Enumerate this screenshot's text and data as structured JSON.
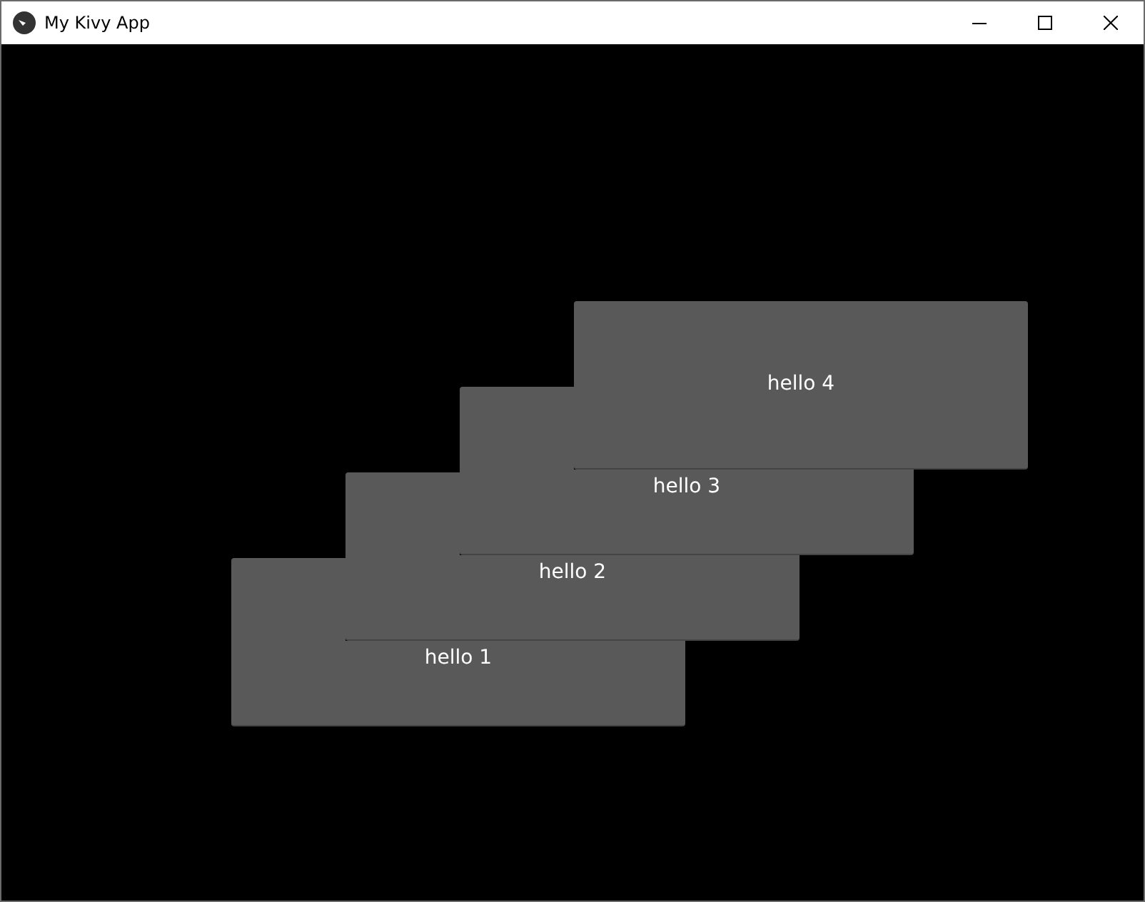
{
  "window": {
    "title": "My Kivy App"
  },
  "buttons": [
    {
      "label": "hello 1"
    },
    {
      "label": "hello 2"
    },
    {
      "label": "hello 3"
    },
    {
      "label": "hello 4"
    }
  ]
}
